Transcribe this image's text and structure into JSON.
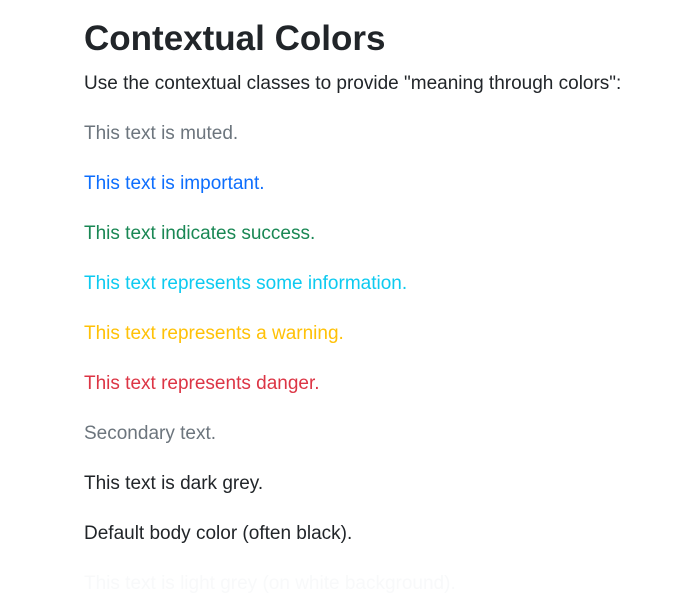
{
  "heading": "Contextual Colors",
  "intro": "Use the contextual classes to provide \"meaning through colors\":",
  "lines": [
    {
      "text": "This text is muted.",
      "color": "#6c757d"
    },
    {
      "text": "This text is important.",
      "color": "#0d6efd"
    },
    {
      "text": "This text indicates success.",
      "color": "#198754"
    },
    {
      "text": "This text represents some information.",
      "color": "#0dcaf0"
    },
    {
      "text": "This text represents a warning.",
      "color": "#ffc107"
    },
    {
      "text": "This text represents danger.",
      "color": "#dc3545"
    },
    {
      "text": "Secondary text.",
      "color": "#6c757d"
    },
    {
      "text": "This text is dark grey.",
      "color": "#212529"
    },
    {
      "text": "Default body color (often black).",
      "color": "#212529"
    },
    {
      "text": "This text is light grey (on white background).",
      "color": "#f8f9fa"
    }
  ]
}
